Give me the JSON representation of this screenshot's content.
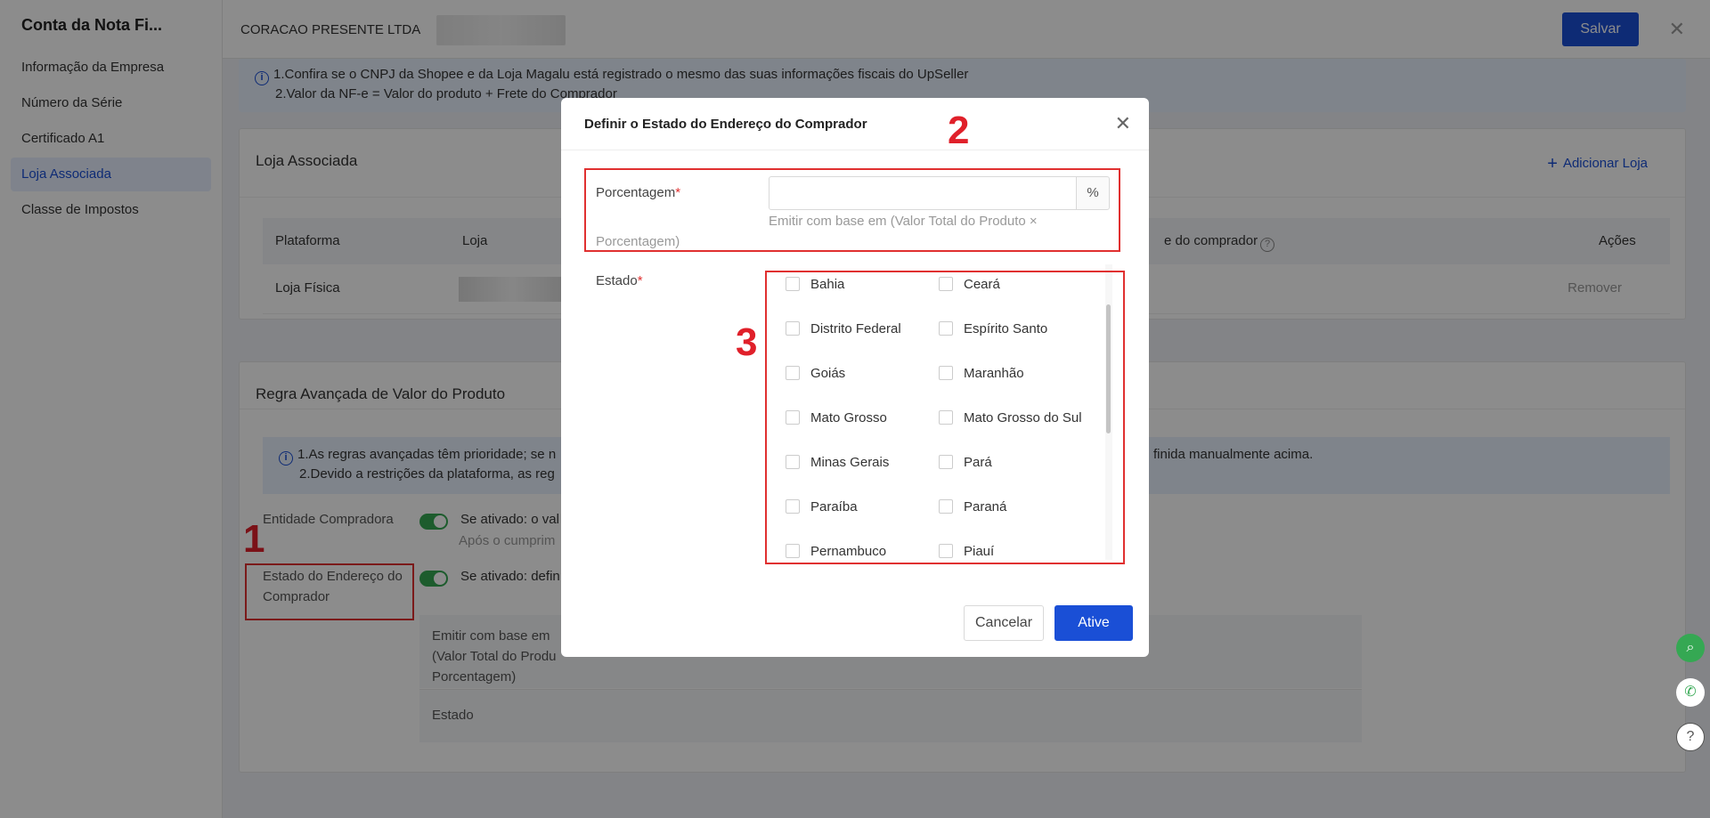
{
  "sidebar": {
    "title": "Conta da Nota Fi...",
    "items": [
      {
        "label": "Informação da Empresa"
      },
      {
        "label": "Número da Série"
      },
      {
        "label": "Certificado A1"
      },
      {
        "label": "Loja Associada"
      },
      {
        "label": "Classe de Impostos"
      }
    ]
  },
  "header": {
    "company": "CORACAO PRESENTE LTDA",
    "save_label": "Salvar",
    "close_glyph": "✕"
  },
  "banner": {
    "line1": "1.Confira se o CNPJ da Shopee e da Loja Magalu está registrado o mesmo das suas informações fiscais do UpSeller",
    "line2": "2.Valor da NF-e = Valor do produto + Frete do Comprador"
  },
  "store_card": {
    "title": "Loja Associada",
    "add_label": "Adicionar Loja",
    "columns": [
      "Plataforma",
      "Loja",
      "e do comprador",
      "Ações"
    ],
    "row": {
      "platform": "Loja Física",
      "action": "Remover"
    }
  },
  "rule_card": {
    "title": "Regra Avançada de Valor do Produto",
    "banner_line1_left": "1.As regras avançadas têm prioridade; se n",
    "banner_line1_right": "finida manualmente acima.",
    "banner_line2": "2.Devido a restrições da plataforma, as reg",
    "entity_label": "Entidade Compradora",
    "entity_text": "Se ativado: o val",
    "entity_sub": "Após o cumprim",
    "state_label_1": "Estado do Endereço do",
    "state_label_2": "Comprador",
    "state_text": "Se ativado: defin",
    "detail_1": "Emitir com base em",
    "detail_2": "(Valor Total do Produ",
    "detail_3": "Porcentagem)",
    "detail_estado": "Estado"
  },
  "annotations": {
    "a1": "1",
    "a2": "2",
    "a3": "3"
  },
  "modal": {
    "title": "Definir o Estado do Endereço do Comprador",
    "close_glyph": "✕",
    "pct_label": "Porcentagem",
    "required_mark": "*",
    "pct_value": "",
    "pct_suffix": "%",
    "pct_help_1": "Emitir com base em (Valor Total do Produto ×",
    "pct_help_2": "Porcentagem)",
    "estado_label": "Estado",
    "states": [
      "Bahia",
      "Ceará",
      "Distrito Federal",
      "Espírito Santo",
      "Goiás",
      "Maranhão",
      "Mato Grosso",
      "Mato Grosso do Sul",
      "Minas Gerais",
      "Pará",
      "Paraíba",
      "Paraná",
      "Pernambuco",
      "Piauí"
    ],
    "cancel_label": "Cancelar",
    "confirm_label": "Ative"
  },
  "fabs": {
    "search_glyph": "⌕",
    "chat_glyph": "✆",
    "help_glyph": "?"
  },
  "colors": {
    "accent": "#1a4fd6",
    "annotation_red": "#e03030",
    "toggle_green": "#35a853"
  }
}
